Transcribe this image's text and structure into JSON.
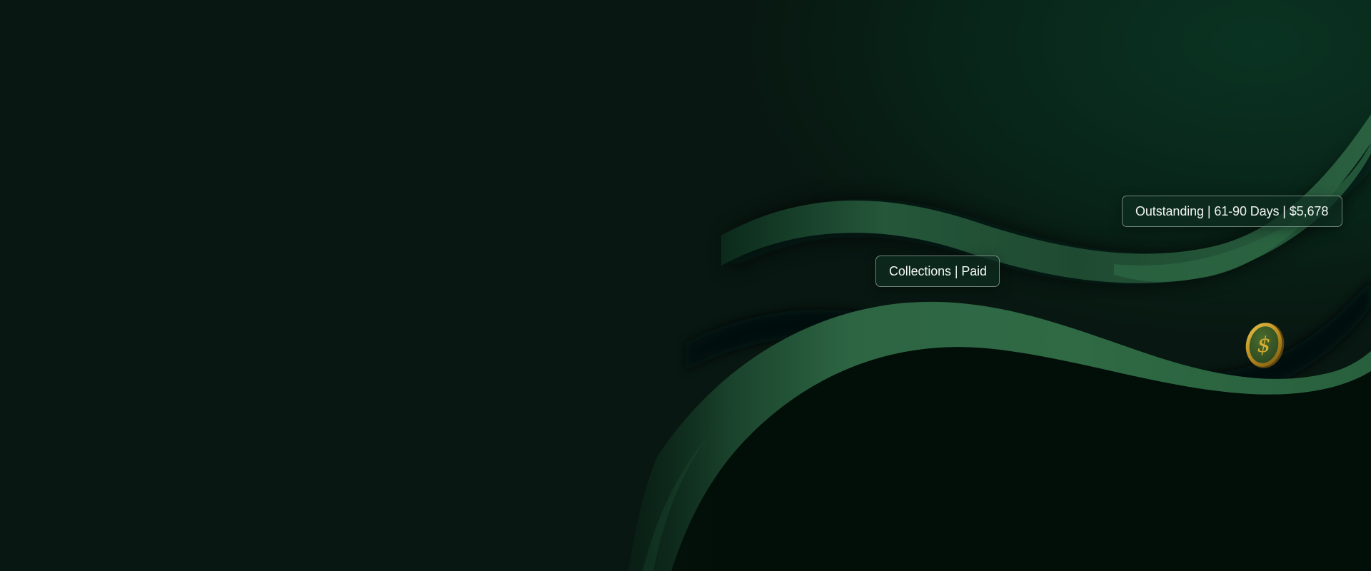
{
  "tags": {
    "collections": "Collections | Paid",
    "outstanding": "Outstanding | 61-90 Days | $5,678"
  },
  "coin": {
    "symbol": "$",
    "icon": "dollar-coin-icon",
    "color": "#c9a22b"
  },
  "colors": {
    "background": "#081711",
    "ribbon_light": "#2f6a44",
    "ribbon_dark": "#0a2818"
  }
}
